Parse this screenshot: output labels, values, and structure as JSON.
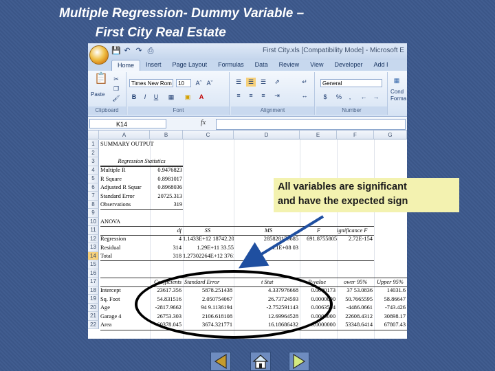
{
  "slide": {
    "title_line1": "Multiple Regression- Dummy Variable –",
    "title_line2": "First City Real Estate",
    "callout_line1": "All variables are significant",
    "callout_line2": "and have the expected sign"
  },
  "excel": {
    "window_title": "First City.xls  [Compatibility Mode] - Microsoft E",
    "quick_access": [
      "save-icon",
      "undo-icon",
      "redo-icon",
      "print-icon"
    ],
    "tabs": [
      "Home",
      "Insert",
      "Page Layout",
      "Formulas",
      "Data",
      "Review",
      "View",
      "Developer",
      "Add I"
    ],
    "active_tab": "Home",
    "ribbon": {
      "clipboard_label": "Clipboard",
      "paste_label": "Paste",
      "font_label": "Font",
      "font_name": "Times New Rom",
      "font_size": "10",
      "alignment_label": "Alignment",
      "number_label": "Number",
      "number_format": "General",
      "styles_label1": "Cond",
      "styles_label2": "Forma",
      "bold": "B",
      "italic": "I",
      "underline": "U",
      "font_color_glyph": "A",
      "dollar": "$",
      "percent": "%",
      "comma": ","
    },
    "name_box": "K14",
    "fx": "fx",
    "columns": [
      "A",
      "B",
      "C",
      "D",
      "E",
      "F",
      "G"
    ],
    "rows": [
      "1",
      "2",
      "3",
      "4",
      "5",
      "6",
      "7",
      "8",
      "9",
      "10",
      "11",
      "12",
      "13",
      "14",
      "15",
      "16",
      "17",
      "18",
      "19",
      "20",
      "21",
      "22"
    ],
    "selected_row": "14",
    "sheet": {
      "r1": "SUMMARY OUTPUT",
      "r3": "Regression Statistics",
      "stats": [
        {
          "label": "Multiple R",
          "value": "0.9476823"
        },
        {
          "label": "R Square",
          "value": "0.8981017"
        },
        {
          "label": "Adjusted R Squar",
          "value": "0.8968036"
        },
        {
          "label": "Standard Error",
          "value": "20725.313"
        },
        {
          "label": "Observations",
          "value": "319"
        }
      ],
      "r10": "ANOVA",
      "anova_headers": [
        "df",
        "SS",
        "MS",
        "F",
        "ignificance F"
      ],
      "anova": [
        {
          "label": "Regression",
          "df": "4",
          "ss": "1.1433E+12 18742.20",
          "ms": "285828179685",
          "f": "691.8755805",
          "sig": "2.72E-154"
        },
        {
          "label": "Residual",
          "df": "314",
          "ss": "1.29E+11 33.55",
          "ms": "4.1E+08 03",
          "f": "",
          "sig": ""
        },
        {
          "label": "Total",
          "df": "318",
          "ss": "1.27302264E+12 3761.75",
          "ms": "",
          "f": "",
          "sig": ""
        }
      ],
      "coef_headers": [
        "Coefficients",
        "Standard Error",
        "t Stat",
        "P-value",
        "ower 95%",
        "Upper 95%"
      ],
      "coef": [
        {
          "label": "Intercept",
          "coef": "23617.356",
          "se": "5878.251438",
          "t": "4.337976668",
          "p": "0.0000173",
          "lower": "37 53.0836",
          "upper": "14031.6"
        },
        {
          "label": "Sq. Foot",
          "coef": "54.831516",
          "se": "2.050754067",
          "t": "26.73724593",
          "p": "0.0000000",
          "lower": "50.7665595",
          "upper": "58.86647"
        },
        {
          "label": "Age",
          "coef": "-2817.9662",
          "se": "94 9.1136194",
          "t": "-2.752591143",
          "p": "0.0063504",
          "lower": "-4486.0661",
          "upper": "-743.426"
        },
        {
          "label": "Garage 4",
          "coef": "26753.303",
          "se": "2106.618108",
          "t": "12.69964528",
          "p": "0.0000000",
          "lower": "22608.4312",
          "upper": "30898.17"
        },
        {
          "label": "Area",
          "coef": "60378.045",
          "se": "3674.321771",
          "t": "16.18686432",
          "p": "0.0000000",
          "lower": "53348.6414",
          "upper": "67807.43"
        }
      ]
    }
  },
  "nav": {
    "prev_icon": "previous-slide-icon",
    "home_icon": "home-icon",
    "next_icon": "next-slide-icon"
  },
  "colors": {
    "slide_background": "#3e5a8c",
    "callout_fill": "#f3f2b0",
    "arrow": "#1f4fa0",
    "selected_row_header": "#f6d07a"
  }
}
